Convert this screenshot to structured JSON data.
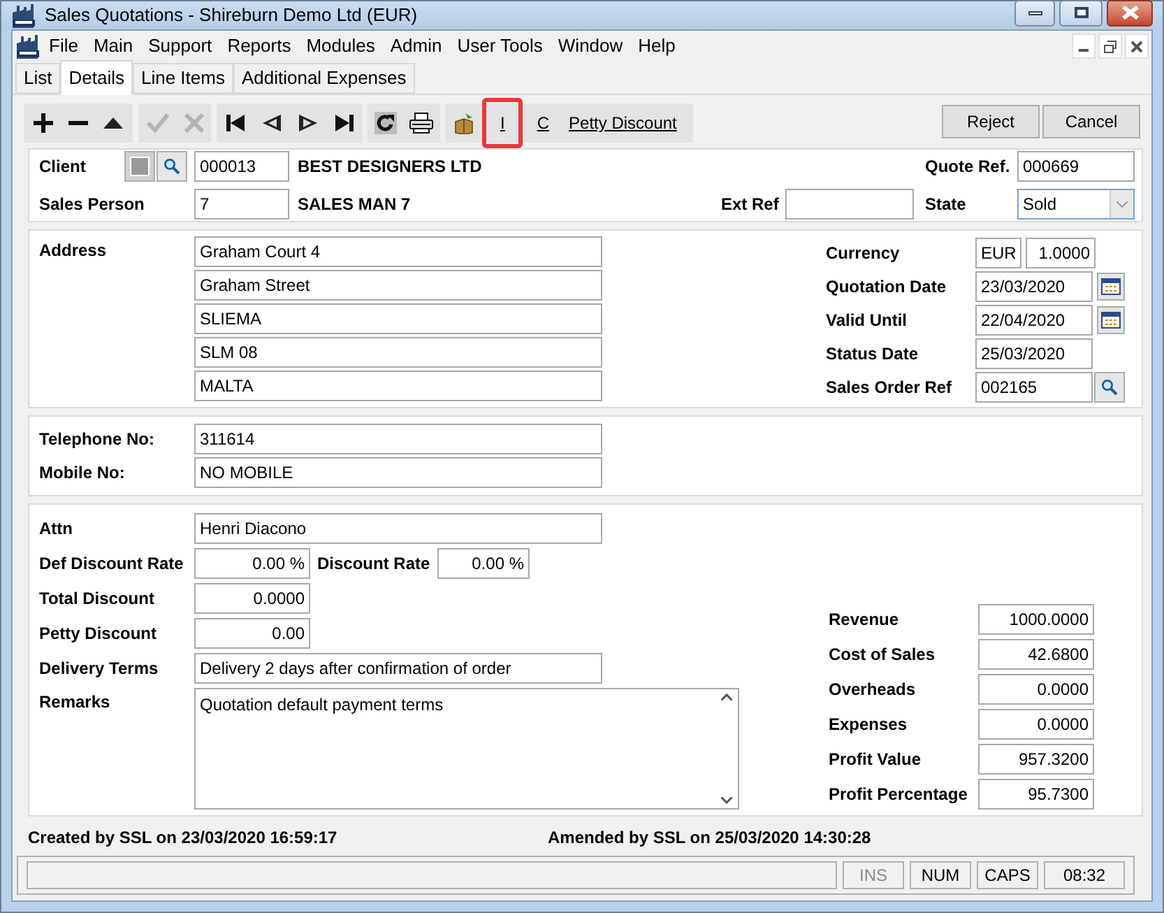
{
  "window": {
    "title": "Sales Quotations - Shireburn Demo Ltd (EUR)"
  },
  "menu": [
    "File",
    "Main",
    "Support",
    "Reports",
    "Modules",
    "Admin",
    "User Tools",
    "Window",
    "Help"
  ],
  "tabs": [
    {
      "label": "List",
      "selected": false
    },
    {
      "label": "Details",
      "selected": true
    },
    {
      "label": "Line Items",
      "selected": false
    },
    {
      "label": "Additional Expenses",
      "selected": false
    }
  ],
  "toolbar": {
    "confirm_buttons": [
      {
        "disabled": true
      },
      {
        "disabled": true
      }
    ],
    "text_buttons": [
      {
        "label": "I",
        "highlighted": true
      },
      {
        "label": "C",
        "highlighted": false
      },
      {
        "label": "Petty Discount",
        "highlighted": false
      }
    ],
    "actions": [
      "Reject",
      "Cancel"
    ]
  },
  "header": {
    "client": {
      "label": "Client",
      "code": "000013",
      "name": "BEST DESIGNERS LTD"
    },
    "sales_person": {
      "label": "Sales Person",
      "code": "7",
      "name": "SALES MAN 7"
    },
    "quote_ref": {
      "label": "Quote Ref.",
      "value": "000669"
    },
    "ext_ref": {
      "label": "Ext Ref"
    },
    "state": {
      "label": "State",
      "value": "Sold"
    }
  },
  "address": {
    "label": "Address",
    "lines": [
      "Graham Court 4",
      "Graham Street",
      "SLIEMA",
      "SLM 08",
      "MALTA"
    ]
  },
  "currency": {
    "label": "Currency",
    "code": "EUR",
    "rate": "1.0000"
  },
  "dates": [
    {
      "label": "Quotation Date",
      "value": "23/03/2020",
      "kind": "date"
    },
    {
      "label": "Valid Until",
      "value": "22/04/2020",
      "kind": "date"
    },
    {
      "label": "Status Date",
      "value": "25/03/2020",
      "kind": "plain"
    },
    {
      "label": "Sales Order Ref",
      "value": "002165",
      "kind": "lookup"
    }
  ],
  "contact": [
    {
      "label": "Telephone No:",
      "value": "311614"
    },
    {
      "label": "Mobile No:",
      "value": "NO MOBILE"
    }
  ],
  "details": {
    "attn": {
      "label": "Attn",
      "value": "Henri Diacono"
    },
    "def_discount_rate": {
      "label": "Def Discount Rate",
      "value": "0.00 %"
    },
    "discount_rate": {
      "label": "Discount Rate",
      "value": "0.00 %"
    },
    "total_discount": {
      "label": "Total Discount",
      "value": "0.0000"
    },
    "petty_discount": {
      "label": "Petty Discount",
      "value": "0.00"
    },
    "delivery_terms": {
      "label": "Delivery Terms",
      "value": "Delivery 2 days after confirmation of order"
    },
    "remarks": {
      "label": "Remarks",
      "value": "Quotation default payment terms"
    }
  },
  "totals": [
    {
      "label": "Revenue",
      "value": "1000.0000"
    },
    {
      "label": "Cost of Sales",
      "value": "42.6800"
    },
    {
      "label": "Overheads",
      "value": "0.0000"
    },
    {
      "label": "Expenses",
      "value": "0.0000"
    },
    {
      "label": "Profit Value",
      "value": "957.3200"
    },
    {
      "label": "Profit Percentage",
      "value": "95.7300"
    }
  ],
  "footer": {
    "created": "Created by SSL on 23/03/2020 16:59:17",
    "amended": "Amended by SSL on 25/03/2020 14:30:28"
  },
  "status_bar": [
    {
      "text": "INS",
      "disabled": true
    },
    {
      "text": "NUM",
      "disabled": false
    },
    {
      "text": "CAPS",
      "disabled": false
    },
    {
      "text": "08:32",
      "disabled": false
    }
  ]
}
